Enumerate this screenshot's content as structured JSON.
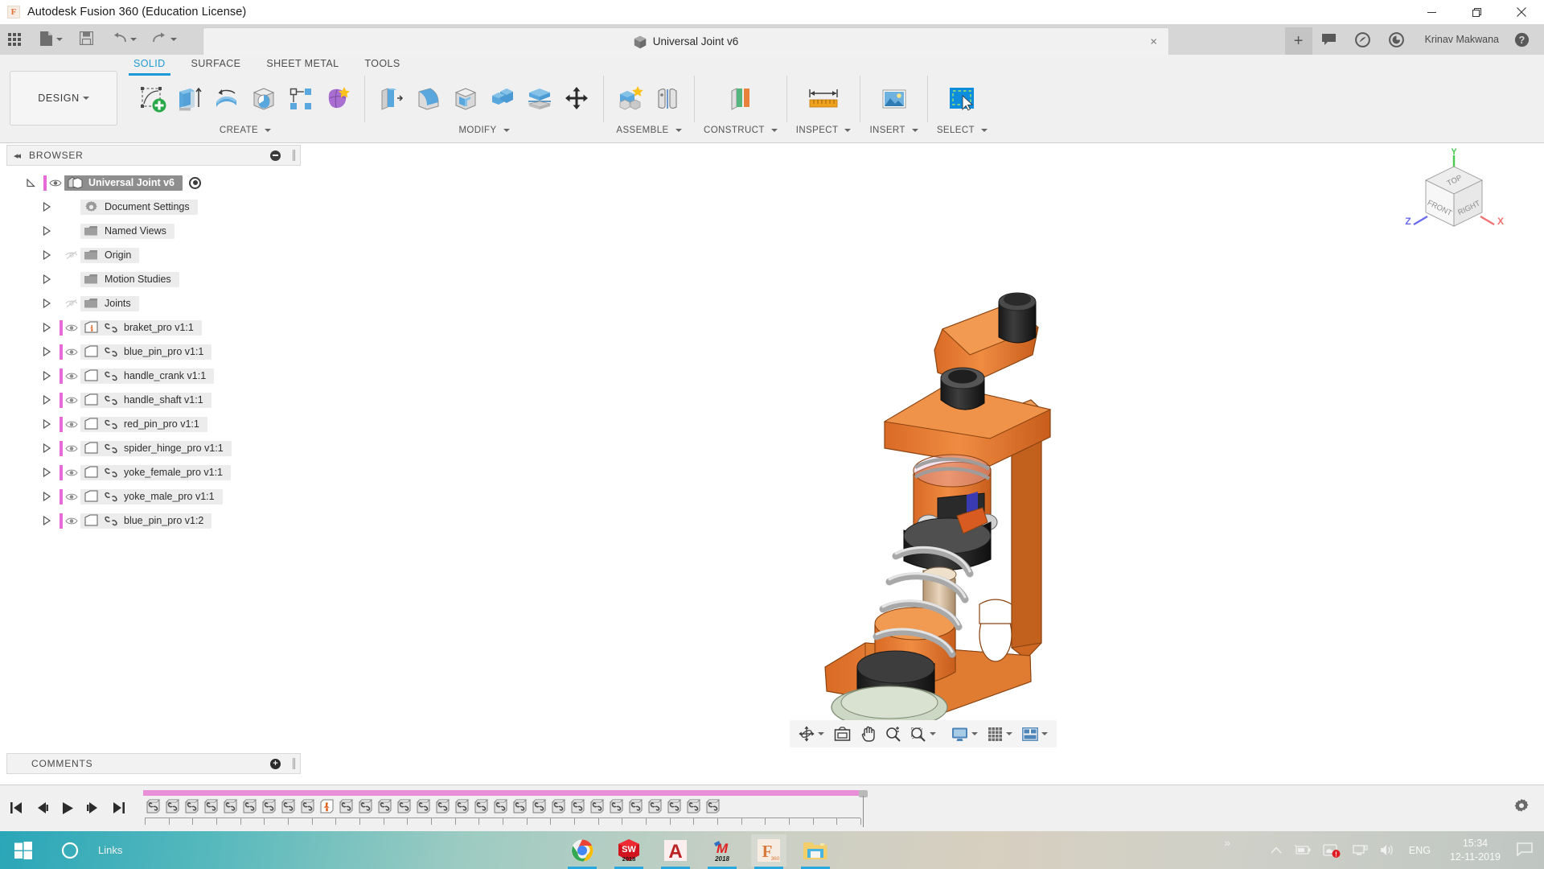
{
  "window": {
    "title": "Autodesk Fusion 360 (Education License)",
    "logo_letter": "F",
    "minimize_label": "Minimize",
    "maximize_label": "Restore",
    "close_label": "Close"
  },
  "quick_access": {
    "items": [
      {
        "name": "app-grid",
        "label": "Show Data Panel"
      },
      {
        "name": "new-file",
        "label": "File"
      },
      {
        "name": "save",
        "label": "Save"
      },
      {
        "name": "undo",
        "label": "Undo"
      },
      {
        "name": "redo",
        "label": "Redo"
      }
    ]
  },
  "document_tab": {
    "label": "Universal Joint v6",
    "close_label": "×",
    "new_tab_label": "+"
  },
  "account_bar": {
    "user": "Krinav Makwana",
    "icons": [
      "comment-icon",
      "extension-icon",
      "job-status-icon",
      "help-icon"
    ]
  },
  "ribbon": {
    "design_label": "DESIGN",
    "tabs": [
      {
        "label": "SOLID",
        "active": true
      },
      {
        "label": "SURFACE",
        "active": false
      },
      {
        "label": "SHEET METAL",
        "active": false
      },
      {
        "label": "TOOLS",
        "active": false
      }
    ],
    "groups": [
      {
        "label": "CREATE",
        "has_dropdown": true,
        "buttons": [
          {
            "name": "create-sketch-button",
            "icon": "sketch-plus-icon"
          },
          {
            "name": "extrude-button",
            "icon": "extrude-icon"
          },
          {
            "name": "revolve-button",
            "icon": "revolve-icon"
          },
          {
            "name": "sweep-button",
            "icon": "sweep-icon"
          },
          {
            "name": "pattern-button",
            "icon": "rectangular-pattern-icon"
          },
          {
            "name": "create-form-button",
            "icon": "form-icon"
          }
        ]
      },
      {
        "label": "MODIFY",
        "has_dropdown": true,
        "buttons": [
          {
            "name": "press-pull-button",
            "icon": "press-pull-icon"
          },
          {
            "name": "fillet-button",
            "icon": "fillet-icon"
          },
          {
            "name": "shell-button",
            "icon": "shell-icon"
          },
          {
            "name": "combine-button",
            "icon": "combine-icon"
          },
          {
            "name": "split-body-button",
            "icon": "split-body-icon"
          },
          {
            "name": "move-copy-button",
            "icon": "move-copy-icon"
          }
        ]
      },
      {
        "label": "ASSEMBLE",
        "has_dropdown": true,
        "buttons": [
          {
            "name": "new-component-button",
            "icon": "new-component-icon"
          },
          {
            "name": "joint-button",
            "icon": "joint-icon"
          }
        ]
      },
      {
        "label": "CONSTRUCT",
        "has_dropdown": true,
        "buttons": [
          {
            "name": "offset-plane-button",
            "icon": "offset-plane-icon"
          }
        ]
      },
      {
        "label": "INSPECT",
        "has_dropdown": true,
        "buttons": [
          {
            "name": "measure-button",
            "icon": "measure-icon"
          }
        ]
      },
      {
        "label": "INSERT",
        "has_dropdown": true,
        "buttons": [
          {
            "name": "insert-image-button",
            "icon": "insert-image-icon"
          }
        ]
      },
      {
        "label": "SELECT",
        "has_dropdown": true,
        "buttons": [
          {
            "name": "select-button",
            "icon": "select-window-icon"
          }
        ]
      }
    ]
  },
  "browser": {
    "header": "BROWSER",
    "collapse_label": "◂◂",
    "nodes": [
      {
        "label": "Universal Joint v6",
        "kind": "root",
        "selected": true,
        "icon": "document-icon",
        "eye": "visible",
        "pink": true,
        "radio": true,
        "indent": 0
      },
      {
        "label": "Document Settings",
        "kind": "settings",
        "selected": false,
        "icon": "gear-icon",
        "eye": "none",
        "pink": false,
        "indent": 1
      },
      {
        "label": "Named Views",
        "kind": "folder",
        "selected": false,
        "icon": "folder-icon",
        "eye": "none",
        "pink": false,
        "indent": 1
      },
      {
        "label": "Origin",
        "kind": "folder",
        "selected": false,
        "icon": "folder-icon",
        "eye": "hidden",
        "pink": false,
        "indent": 1
      },
      {
        "label": "Motion Studies",
        "kind": "folder",
        "selected": false,
        "icon": "folder-icon",
        "eye": "none",
        "pink": false,
        "indent": 1
      },
      {
        "label": "Joints",
        "kind": "folder",
        "selected": false,
        "icon": "folder-icon",
        "eye": "hidden",
        "pink": false,
        "indent": 1
      },
      {
        "label": "braket_pro v1:1",
        "kind": "component",
        "selected": false,
        "icon": "grounded-component-icon",
        "eye": "visible",
        "pink": true,
        "link": true,
        "indent": 1
      },
      {
        "label": "blue_pin_pro v1:1",
        "kind": "component",
        "selected": false,
        "icon": "component-icon",
        "eye": "visible",
        "pink": true,
        "link": true,
        "indent": 1
      },
      {
        "label": "handle_crank v1:1",
        "kind": "component",
        "selected": false,
        "icon": "component-icon",
        "eye": "visible",
        "pink": true,
        "link": true,
        "indent": 1
      },
      {
        "label": "handle_shaft v1:1",
        "kind": "component",
        "selected": false,
        "icon": "component-icon",
        "eye": "visible",
        "pink": true,
        "link": true,
        "indent": 1
      },
      {
        "label": "red_pin_pro v1:1",
        "kind": "component",
        "selected": false,
        "icon": "component-icon",
        "eye": "visible",
        "pink": true,
        "link": true,
        "indent": 1
      },
      {
        "label": "spider_hinge_pro v1:1",
        "kind": "component",
        "selected": false,
        "icon": "component-icon",
        "eye": "visible",
        "pink": true,
        "link": true,
        "indent": 1
      },
      {
        "label": "yoke_female_pro v1:1",
        "kind": "component",
        "selected": false,
        "icon": "component-icon",
        "eye": "visible",
        "pink": true,
        "link": true,
        "indent": 1
      },
      {
        "label": "yoke_male_pro v1:1",
        "kind": "component",
        "selected": false,
        "icon": "component-icon",
        "eye": "visible",
        "pink": true,
        "link": true,
        "indent": 1
      },
      {
        "label": "blue_pin_pro v1:2",
        "kind": "component",
        "selected": false,
        "icon": "component-icon",
        "eye": "visible",
        "pink": true,
        "link": true,
        "indent": 1
      }
    ]
  },
  "comments": {
    "header": "COMMENTS",
    "add_label": "+"
  },
  "viewcube": {
    "top_face": "TOP",
    "front_face": "FRONT",
    "right_face": "RIGHT",
    "axis_x": "X",
    "axis_y": "Y",
    "axis_z": "Z"
  },
  "navigation_bar": {
    "buttons": [
      {
        "name": "orbit-button",
        "icon": "orbit-icon",
        "dropdown": true
      },
      {
        "name": "look-at-button",
        "icon": "look-at-icon",
        "dropdown": false
      },
      {
        "name": "pan-button",
        "icon": "pan-hand-icon",
        "dropdown": false
      },
      {
        "name": "zoom-button",
        "icon": "zoom-icon",
        "dropdown": false
      },
      {
        "name": "fit-button",
        "icon": "zoom-window-icon",
        "dropdown": true
      },
      {
        "name": "display-settings-button",
        "icon": "monitor-icon",
        "dropdown": true
      },
      {
        "name": "grid-snaps-button",
        "icon": "grid-icon",
        "dropdown": true
      },
      {
        "name": "viewports-button",
        "icon": "viewports-icon",
        "dropdown": true
      }
    ]
  },
  "timeline": {
    "playback": [
      {
        "name": "go-to-beginning-button",
        "icon": "skip-start-icon"
      },
      {
        "name": "step-back-button",
        "icon": "step-back-icon"
      },
      {
        "name": "play-button",
        "icon": "play-icon"
      },
      {
        "name": "step-forward-button",
        "icon": "step-forward-icon"
      },
      {
        "name": "go-to-end-button",
        "icon": "skip-end-icon"
      }
    ],
    "feature_count": 30,
    "feature_icon": "joint-feature-icon",
    "special_index": 9,
    "special_icon": "ground-pin-icon",
    "settings_icon": "gear-icon"
  },
  "taskbar": {
    "start_label": "Start",
    "cortana_label": "Cortana",
    "links_label": "Links",
    "apps": [
      {
        "name": "chrome",
        "label": "Google Chrome",
        "active": true
      },
      {
        "name": "solidworks",
        "label": "SOLIDWORKS",
        "badge": "2018",
        "active": true
      },
      {
        "name": "autocad",
        "label": "AutoCAD",
        "active": true
      },
      {
        "name": "mastercam",
        "label": "Mastercam",
        "badge": "2018",
        "active": true
      },
      {
        "name": "fusion360",
        "label": "Fusion 360",
        "badge": "360",
        "active": true,
        "focused": true
      },
      {
        "name": "explorer",
        "label": "File Explorer",
        "active": true
      }
    ],
    "overflow": "»",
    "tray_icons": [
      "show-hidden-icon",
      "battery-icon",
      "onedrive-alert-icon",
      "network-icon",
      "volume-icon"
    ],
    "language": "ENG",
    "time": "15:34",
    "date": "12-11-2019",
    "notification_label": "Notifications"
  }
}
